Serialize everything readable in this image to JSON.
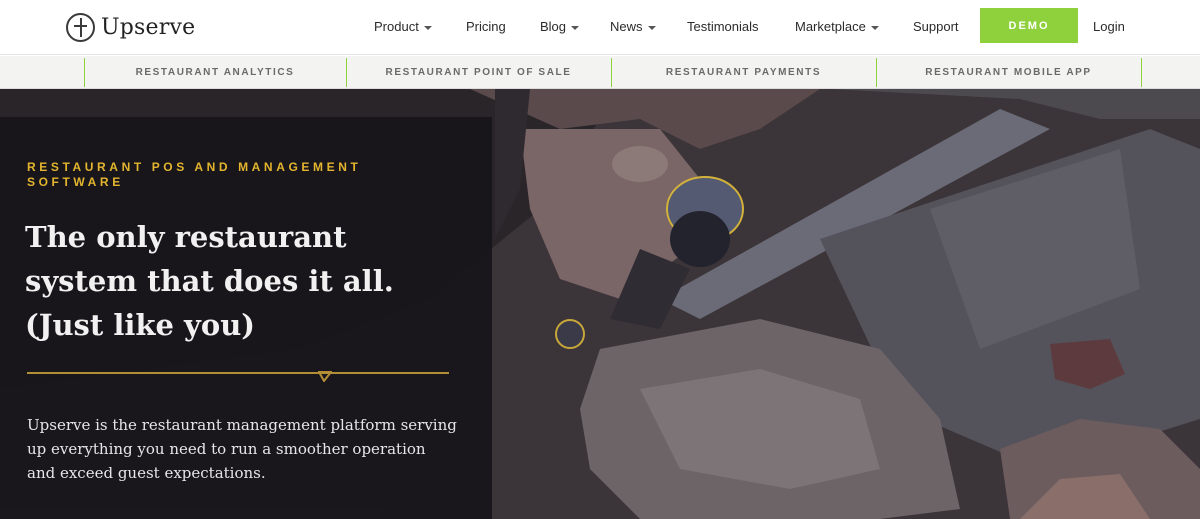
{
  "brand": {
    "name": "Upserve",
    "logo_icon": "upserve-fork-logo-icon"
  },
  "nav": {
    "items": [
      {
        "label": "Product",
        "has_caret": true
      },
      {
        "label": "Pricing",
        "has_caret": false
      },
      {
        "label": "Blog",
        "has_caret": true
      },
      {
        "label": "News",
        "has_caret": true
      },
      {
        "label": "Testimonials",
        "has_caret": false
      },
      {
        "label": "Marketplace",
        "has_caret": true
      },
      {
        "label": "Support",
        "has_caret": false
      }
    ],
    "demo_label": "DEMO",
    "login_label": "Login"
  },
  "subnav": {
    "items": [
      "RESTAURANT ANALYTICS",
      "RESTAURANT POINT OF SALE",
      "RESTAURANT PAYMENTS",
      "RESTAURANT MOBILE APP"
    ]
  },
  "hero": {
    "eyebrow": "RESTAURANT POS AND MANAGEMENT SOFTWARE",
    "headline": "The only restaurant system that does it all. (Just like you)",
    "description": "Upserve is the restaurant management platform serving up everything you need to run a smoother operation and exceed guest expectations."
  },
  "colors": {
    "accent_green": "#8fd13d",
    "eyebrow_gold": "#e3b52e",
    "panel_dark": "#18161a"
  }
}
